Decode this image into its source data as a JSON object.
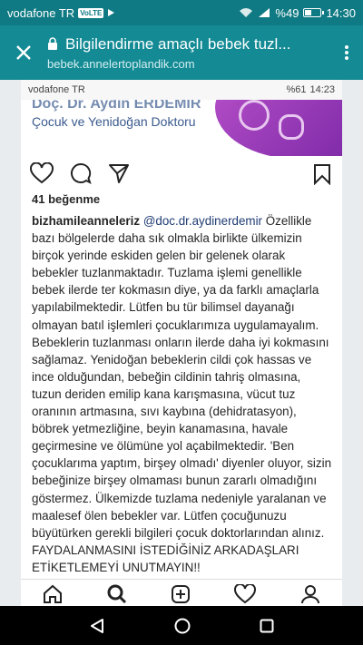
{
  "status_bar": {
    "carrier": "vodafone TR",
    "volte": "VoLTE",
    "battery": "%49",
    "battery_level": 0.49,
    "time": "14:30"
  },
  "tab": {
    "title": "Bilgilendirme amaçlı bebek tuzl...",
    "url": "bebek.annelertoplandik.com"
  },
  "inner_status": {
    "carrier": "vodafone TR",
    "battery": "%61",
    "time": "14:23"
  },
  "profile": {
    "doctor_name": "Doç. Dr. Aydın ERDEMİR",
    "doctor_title": "Çocuk ve Yenidoğan Doktoru"
  },
  "post": {
    "likes": "41 beğenme",
    "username": "bizhamileanneleriz",
    "mention": "@doc.dr.aydinerdemir",
    "caption": " Özellikle bazı bölgelerde daha sık olmakla birlikte ülkemizin birçok yerinde eskiden gelen bir gelenek olarak bebekler tuzlanmaktadır. Tuzlama işlemi genellikle bebek ilerde ter kokmasın diye, ya da farklı amaçlarla yapılabilmektedir. Lütfen bu tür bilimsel dayanağı olmayan batıl işlemleri çocuklarımıza uygulamayalım. Bebeklerin tuzlanması onların ilerde daha iyi kokmasını sağlamaz. Yenidoğan bebeklerin cildi çok hassas ve ince olduğundan, bebeğin cildinin tahriş olmasına, tuzun deriden emilip kana karışmasına, vücut tuz oranının artmasına, sıvı kaybına (dehidratasyon), böbrek yetmezliğine, beyin kanamasına, havale geçirmesine ve ölümüne yol açabilmektedir. 'Ben çocuklarıma yaptım, birşey olmadı' diyenler oluyor, sizin bebeğinize birşey olmaması bunun zararlı olmadığını göstermez. Ülkemizde tuzlama nedeniyle yaralanan ve maalesef ölen bebekler var. Lütfen çocuğunuzu büyütürken gerekli bilgileri çocuk doktorlarından alınız. FAYDALANMASINI İSTEDİĞİNİZ ARKADAŞLARI ETİKETLEMEYİ UNUTMAYIN!!"
  },
  "icons": [
    "close-icon",
    "lock-icon",
    "overflow-menu-icon",
    "heart-icon",
    "comment-icon",
    "share-icon",
    "bookmark-icon",
    "home-icon",
    "search-icon",
    "add-post-icon",
    "activity-icon",
    "profile-icon",
    "back-icon",
    "home-circle-icon",
    "recents-icon"
  ],
  "colors": {
    "status_bar": "#0f7a83",
    "toolbar": "#138a94",
    "accent_purple": "#9b3cb8",
    "mention": "#1f3b73"
  }
}
